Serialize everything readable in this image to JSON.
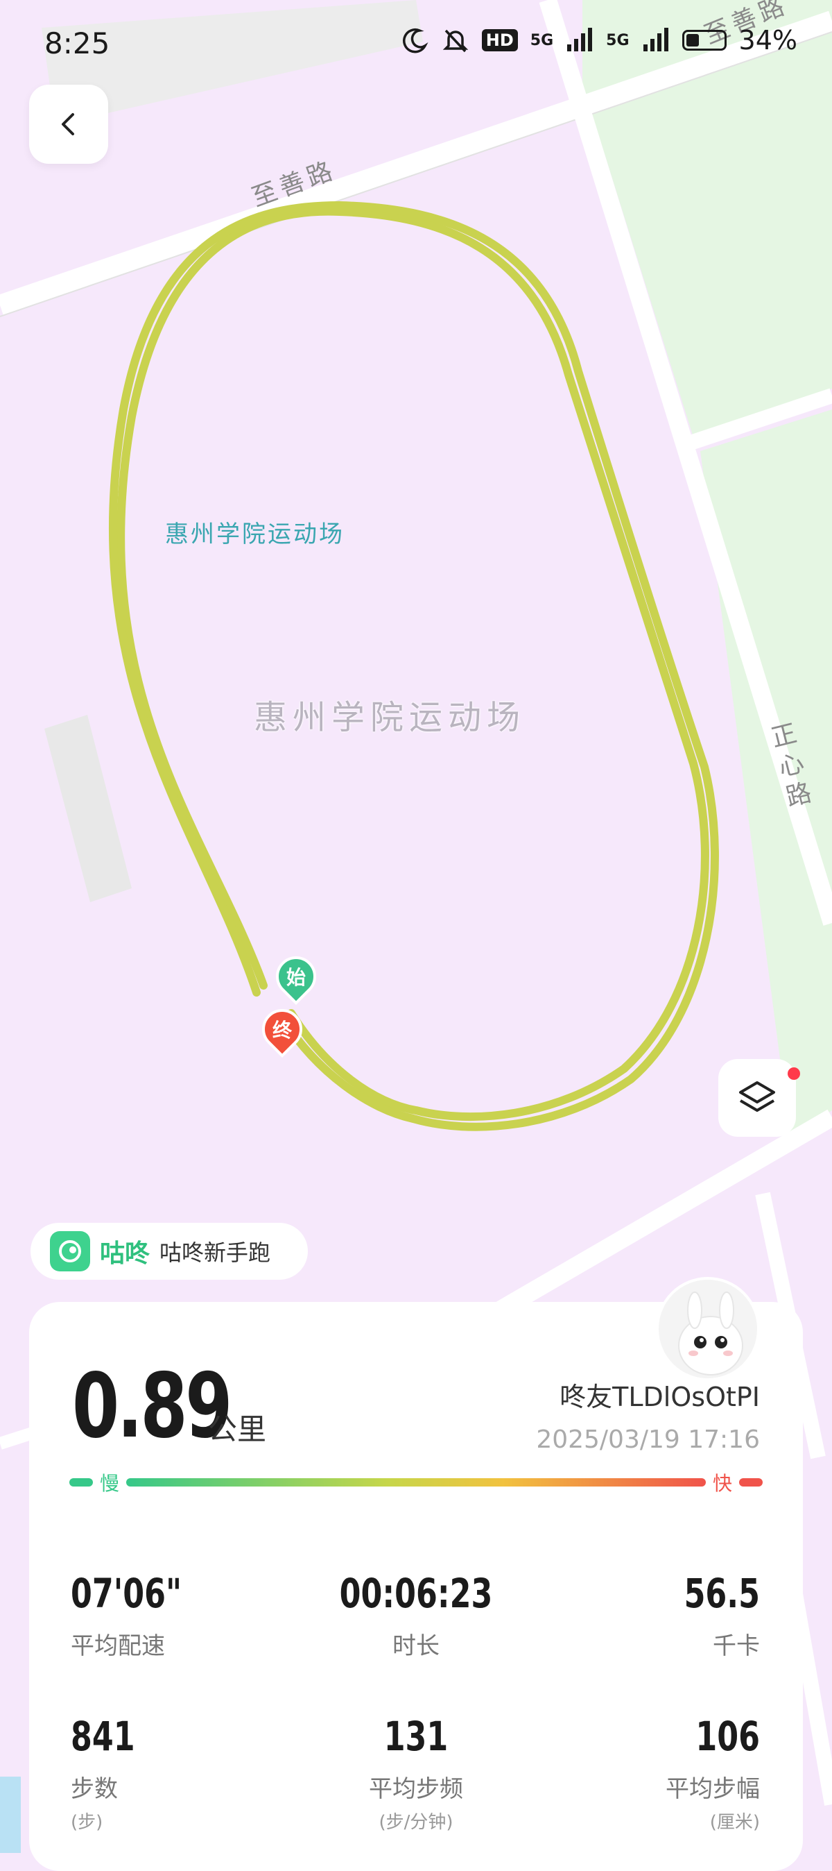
{
  "status_bar": {
    "time": "8:25",
    "hd_badge": "HD",
    "signal1": "5G",
    "signal2": "5G",
    "battery": "34%",
    "icons": [
      "moon-icon",
      "bell-off-icon",
      "signal-icon",
      "battery-icon"
    ]
  },
  "map": {
    "venue_label_small": "惠州学院运动场",
    "venue_label_big": "惠州学院运动场",
    "road_label_1": "至善路",
    "road_label_2": "至善路",
    "road_label_3": "正心路",
    "start_marker": "始",
    "end_marker": "终",
    "track_color": "#c9d24f"
  },
  "app_chip": {
    "name": "咕咚",
    "subtitle": "咕咚新手跑"
  },
  "summary": {
    "distance": "0.89",
    "distance_unit": "公里",
    "user_name": "咚友TLDlOsOtPI",
    "datetime": "2025/03/19 17:16",
    "pace_slow": "慢",
    "pace_fast": "快"
  },
  "stats": [
    {
      "value": "07'06\"",
      "label": "平均配速",
      "sub": ""
    },
    {
      "value": "00:06:23",
      "label": "时长",
      "sub": ""
    },
    {
      "value": "56.5",
      "label": "千卡",
      "sub": ""
    },
    {
      "value": "841",
      "label": "步数",
      "sub": "(步)"
    },
    {
      "value": "131",
      "label": "平均步频",
      "sub": "(步/分钟)"
    },
    {
      "value": "106",
      "label": "平均步幅",
      "sub": "(厘米)"
    }
  ]
}
